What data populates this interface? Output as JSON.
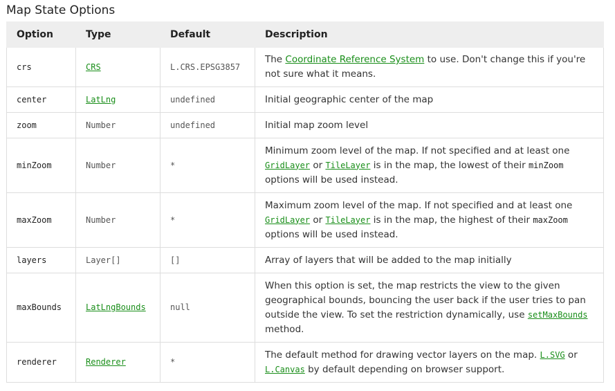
{
  "section_title": "Map State Options",
  "headers": {
    "option": "Option",
    "type": "Type",
    "default": "Default",
    "description": "Description"
  },
  "rows": [
    {
      "option": "crs",
      "type": "CRS",
      "default": "L.CRS.EPSG3857",
      "desc": {
        "a": "The ",
        "link": "Coordinate Reference System",
        "b": " to use. Don't change this if you're not sure what it means."
      }
    },
    {
      "option": "center",
      "type": "LatLng",
      "default": "undefined",
      "desc": {
        "text": "Initial geographic center of the map"
      }
    },
    {
      "option": "zoom",
      "type": "Number",
      "default": "undefined",
      "desc": {
        "text": "Initial map zoom level"
      }
    },
    {
      "option": "minZoom",
      "type": "Number",
      "default": "*",
      "desc": {
        "a": "Minimum zoom level of the map. If not specified and at least one ",
        "link1": "GridLayer",
        "b": " or ",
        "link2": "TileLayer",
        "c": " is in the map, the lowest of their ",
        "code": "minZoom",
        "d": " options will be used instead."
      }
    },
    {
      "option": "maxZoom",
      "type": "Number",
      "default": "*",
      "desc": {
        "a": "Maximum zoom level of the map. If not specified and at least one ",
        "link1": "GridLayer",
        "b": " or ",
        "link2": "TileLayer",
        "c": " is in the map, the highest of their ",
        "code": "maxZoom",
        "d": " options will be used instead."
      }
    },
    {
      "option": "layers",
      "type": "Layer[]",
      "default": "[]",
      "desc": {
        "text": "Array of layers that will be added to the map initially"
      }
    },
    {
      "option": "maxBounds",
      "type": "LatLngBounds",
      "default": "null",
      "desc": {
        "a": "When this option is set, the map restricts the view to the given geographical bounds, bouncing the user back if the user tries to pan outside the view. To set the restriction dynamically, use ",
        "link": "setMaxBounds",
        "b": " method."
      }
    },
    {
      "option": "renderer",
      "type": "Renderer",
      "default": "*",
      "desc": {
        "a": "The default method for drawing vector layers on the map. ",
        "link1": "L.SVG",
        "b": " or ",
        "link2": "L.Canvas",
        "c": " by default depending on browser support."
      }
    }
  ]
}
